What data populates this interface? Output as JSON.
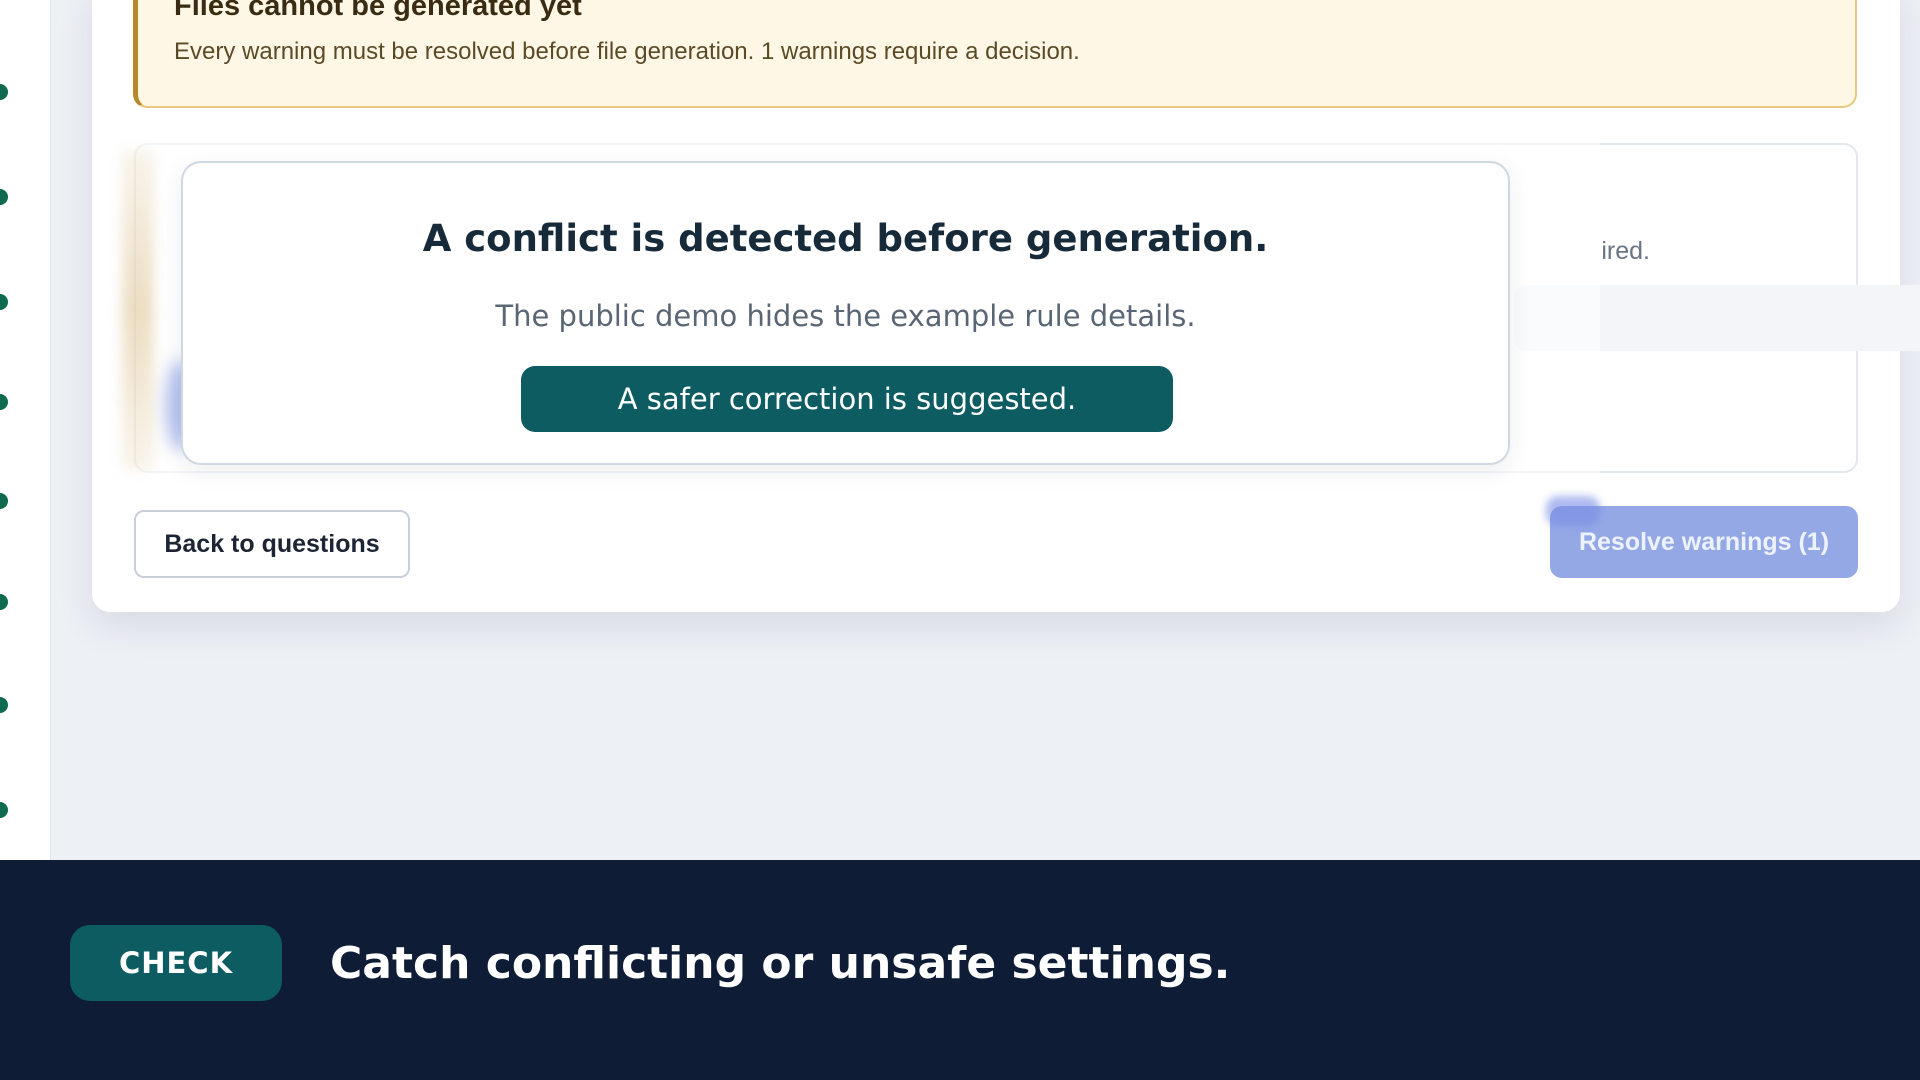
{
  "alert": {
    "title": "Files cannot be generated yet",
    "body": "Every warning must be resolved before file generation. 1 warnings require a decision."
  },
  "panel": {
    "partial_text": "ired."
  },
  "modal": {
    "title": "A conflict is detected before generation.",
    "subtitle": "The public demo hides the example rule details.",
    "cta_label": "A safer correction is suggested."
  },
  "actions": {
    "back_label": "Back to questions",
    "resolve_label": "Resolve warnings (1)"
  },
  "banner": {
    "badge_label": "CHECK",
    "text": "Catch conflicting or unsafe settings."
  },
  "colors": {
    "teal": "#0c5c61",
    "banner_bg": "#0f1c36",
    "alert_bg": "#fff7e6",
    "resolve_bg": "#94a8e6"
  }
}
